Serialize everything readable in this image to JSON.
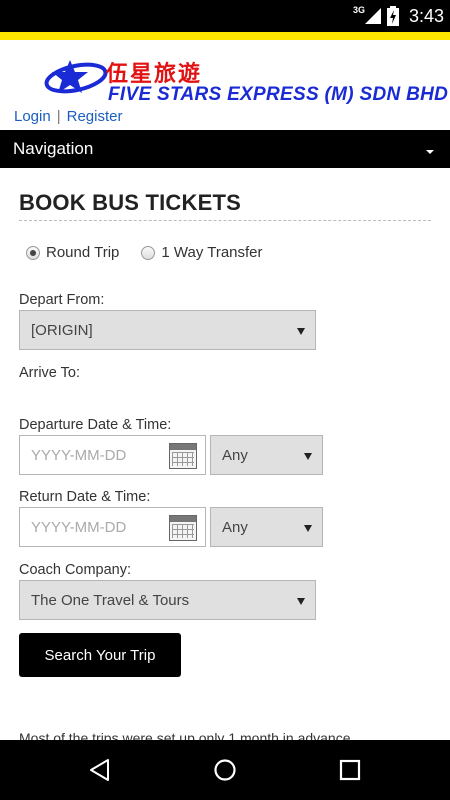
{
  "status_bar": {
    "network": "3G",
    "time": "3:43",
    "icons": [
      "signal-icon",
      "battery-charging-icon"
    ]
  },
  "header": {
    "logo_chinese": "伍星旅遊",
    "logo_english": "FIVE STARS EXPRESS (M) SDN BHD",
    "logo_icon": "star-swoosh-icon",
    "login_label": "Login",
    "separator": "|",
    "register_label": "Register"
  },
  "navigation": {
    "label": "Navigation",
    "icon": "caret-down-icon"
  },
  "form": {
    "title": "BOOK BUS TICKETS",
    "trip_types": [
      {
        "label": "Round Trip",
        "checked": true
      },
      {
        "label": "1 Way Transfer",
        "checked": false
      }
    ],
    "depart_from": {
      "label": "Depart From:",
      "value": "[ORIGIN]"
    },
    "arrive_to": {
      "label": "Arrive To:"
    },
    "departure": {
      "label": "Departure Date & Time:",
      "placeholder": "YYYY-MM-DD",
      "time_value": "Any"
    },
    "return": {
      "label": "Return Date & Time:",
      "placeholder": "YYYY-MM-DD",
      "time_value": "Any"
    },
    "coach_company": {
      "label": "Coach Company:",
      "value": "The One Travel & Tours"
    },
    "submit_label": "Search Your Trip"
  },
  "note": "Most of the trips were set up only 1 month in advance.",
  "bottom_nav": {
    "icons": [
      "back-icon",
      "home-icon",
      "recent-apps-icon"
    ]
  }
}
